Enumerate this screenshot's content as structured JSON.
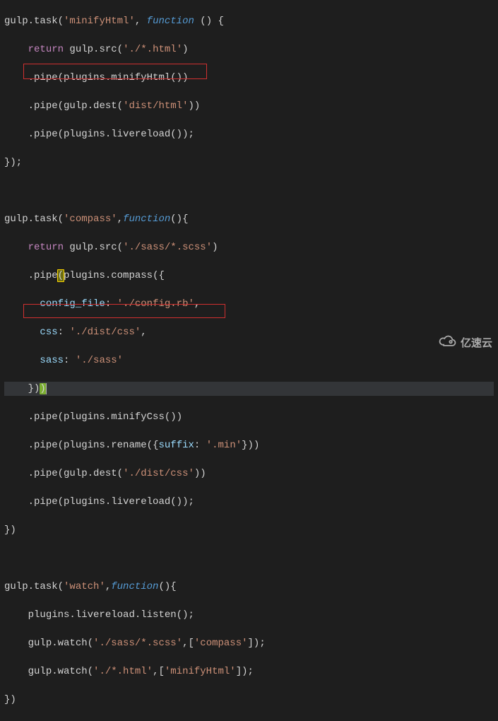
{
  "code": {
    "l1": {
      "a": "gulp",
      "b": ".",
      "c": "task",
      "d": "(",
      "e": "'minifyHtml'",
      "f": ", ",
      "g": "function",
      "h": " () {",
      "all": ""
    },
    "l2": {
      "indent": "    ",
      "ret": "return",
      "rest": " gulp",
      "dot": ".",
      "m": "src",
      "p": "(",
      "s": "'./*.html'",
      "cp": ")"
    },
    "l3": {
      "indent": "    ",
      "dot1": ".",
      "m1": "pipe",
      "p1": "(",
      "obj": "plugins",
      "dot2": ".",
      "m2": "minifyHtml",
      "p2": "()",
      "cp": ")"
    },
    "l4": {
      "indent": "    ",
      "dot1": ".",
      "m1": "pipe",
      "p1": "(",
      "obj": "gulp",
      "dot2": ".",
      "m2": "dest",
      "p2": "(",
      "s": "'dist/html'",
      "cp": "))"
    },
    "l5": {
      "indent": "    ",
      "dot1": ".",
      "m1": "pipe",
      "p1": "(",
      "obj": "plugins",
      "dot2": ".",
      "m2": "livereload",
      "p2": "()",
      "cp": ");"
    },
    "l6": {
      "txt": "});"
    },
    "l7": {
      "txt": ""
    },
    "l8": {
      "a": "gulp",
      "b": ".",
      "c": "task",
      "d": "(",
      "e": "'compass'",
      "f": ",",
      "g": "function",
      "h": "(){"
    },
    "l9": {
      "indent": "    ",
      "ret": "return",
      "rest": " gulp",
      "dot": ".",
      "m": "src",
      "p": "(",
      "s": "'./sass/*.scss'",
      "cp": ")"
    },
    "l10": {
      "indent": "    ",
      "dot1": ".",
      "m1": "pipe",
      "p1": "(",
      "obj": "plugins",
      "dot2": ".",
      "m2": "compass",
      "p2": "({"
    },
    "l11": {
      "indent": "      ",
      "k": "config_file",
      "colon": ": ",
      "s": "'./config.rb'",
      "comma": ","
    },
    "l12": {
      "indent": "      ",
      "k": "css",
      "colon": ": ",
      "s": "'./dist/css'",
      "comma": ","
    },
    "l13": {
      "indent": "      ",
      "k": "sass",
      "colon": ": ",
      "s": "'./sass'"
    },
    "l14": {
      "indent": "    ",
      "txt": "}))"
    },
    "l15": {
      "indent": "    ",
      "dot1": ".",
      "m1": "pipe",
      "p1": "(",
      "obj": "plugins",
      "dot2": ".",
      "m2": "minifyCss",
      "p2": "()",
      "cp": ")"
    },
    "l16": {
      "indent": "    ",
      "dot1": ".",
      "m1": "pipe",
      "p1": "(",
      "obj": "plugins",
      "dot2": ".",
      "m2": "rename",
      "p2": "({",
      "k": "suffix",
      "colon": ": ",
      "s": "'.min'",
      "cp": "}))"
    },
    "l17": {
      "indent": "    ",
      "dot1": ".",
      "m1": "pipe",
      "p1": "(",
      "obj": "gulp",
      "dot2": ".",
      "m2": "dest",
      "p2": "(",
      "s": "'./dist/css'",
      "cp": "))"
    },
    "l18": {
      "indent": "    ",
      "dot1": ".",
      "m1": "pipe",
      "p1": "(",
      "obj": "plugins",
      "dot2": ".",
      "m2": "livereload",
      "p2": "()",
      "cp": ");"
    },
    "l19": {
      "txt": "})"
    },
    "l20": {
      "txt": ""
    },
    "l21": {
      "a": "gulp",
      "b": ".",
      "c": "task",
      "d": "(",
      "e": "'watch'",
      "f": ",",
      "g": "function",
      "h": "(){"
    },
    "l22": {
      "indent": "    ",
      "a": "plugins",
      "b": ".",
      "c": "livereload",
      "d": ".",
      "e": "listen",
      "f": "();"
    },
    "l23": {
      "indent": "    ",
      "a": "gulp",
      "b": ".",
      "c": "watch",
      "d": "(",
      "s": "'./sass/*.scss'",
      "e": ",[",
      "s2": "'compass'",
      "f": "]);"
    },
    "l24": {
      "indent": "    ",
      "a": "gulp",
      "b": ".",
      "c": "watch",
      "d": "(",
      "s": "'./*.html'",
      "e": ",[",
      "s2": "'minifyHtml'",
      "f": "]);"
    },
    "l25": {
      "txt": "})"
    }
  },
  "watermark": {
    "text": "亿速云"
  }
}
